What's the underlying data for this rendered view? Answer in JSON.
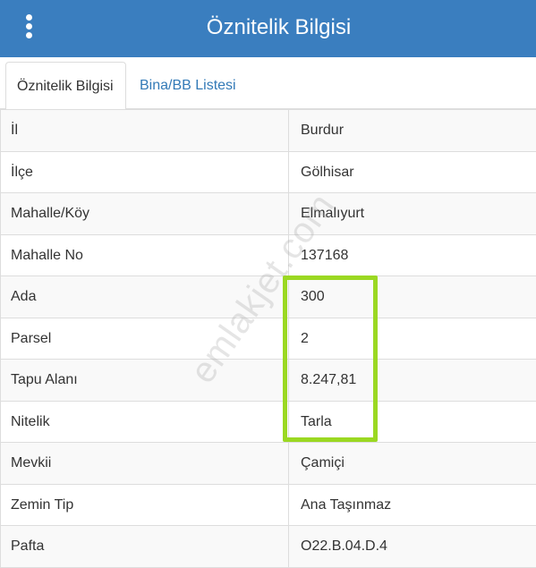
{
  "header": {
    "title": "Öznitelik Bilgisi",
    "menu_icon": "vertical-dots-icon"
  },
  "tabs": [
    {
      "label": "Öznitelik Bilgisi",
      "active": true
    },
    {
      "label": "Bina/BB Listesi",
      "active": false
    }
  ],
  "rows": [
    {
      "key": "İl",
      "value": "Burdur"
    },
    {
      "key": "İlçe",
      "value": "Gölhisar"
    },
    {
      "key": "Mahalle/Köy",
      "value": "Elmalıyurt"
    },
    {
      "key": "Mahalle No",
      "value": "137168"
    },
    {
      "key": "Ada",
      "value": "300"
    },
    {
      "key": "Parsel",
      "value": "2"
    },
    {
      "key": "Tapu Alanı",
      "value": "8.247,81"
    },
    {
      "key": "Nitelik",
      "value": "Tarla"
    },
    {
      "key": "Mevkii",
      "value": "Çamiçi"
    },
    {
      "key": "Zemin Tip",
      "value": "Ana Taşınmaz"
    },
    {
      "key": "Pafta",
      "value": "O22.B.04.D.4"
    }
  ],
  "watermark": "emlakjet.com",
  "colors": {
    "header_bg": "#3a7ebf",
    "link": "#337ab7",
    "highlight": "#9bd822"
  }
}
